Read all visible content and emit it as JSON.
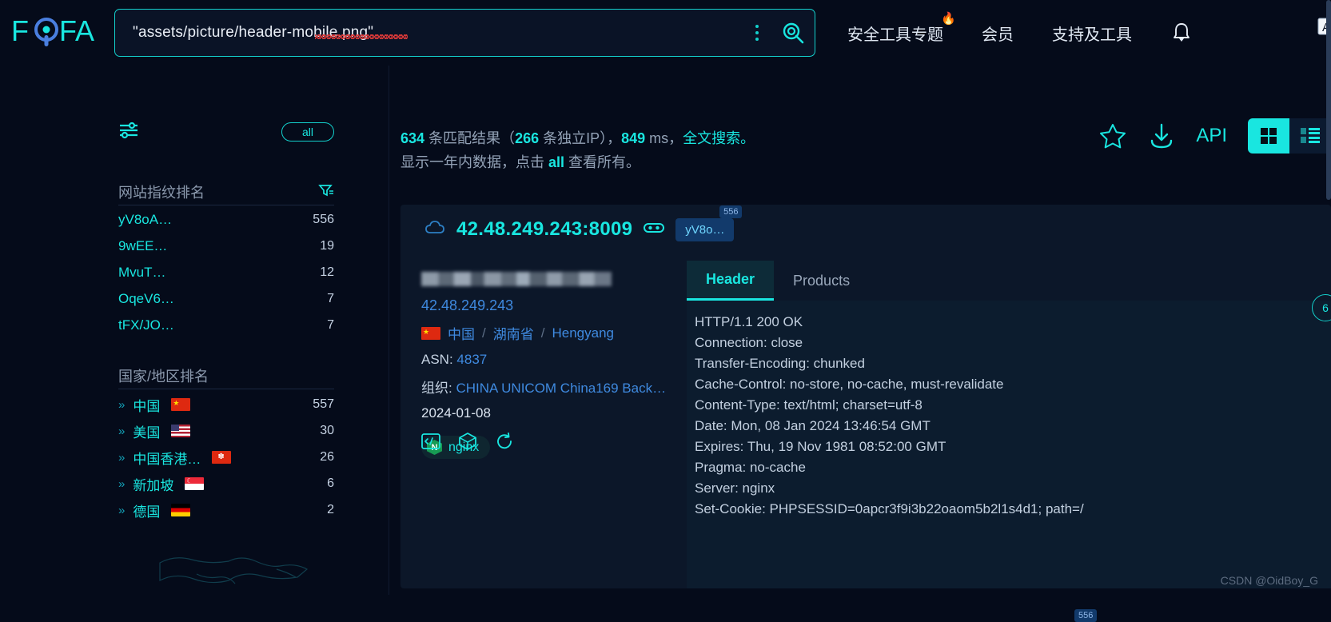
{
  "brand": {
    "name": "FOFA"
  },
  "search": {
    "query": "\"assets/picture/header-mobile.png\""
  },
  "nav": {
    "items": [
      {
        "label": "安全工具专题",
        "hot": true
      },
      {
        "label": "会员",
        "hot": false
      },
      {
        "label": "支持及工具",
        "hot": false
      }
    ]
  },
  "sidebar": {
    "all_label": "all",
    "sections": [
      {
        "title": "网站指纹排名",
        "items": [
          {
            "label": "yV8oA…",
            "count": "556"
          },
          {
            "label": "9wEE…",
            "count": "19"
          },
          {
            "label": "MvuT…",
            "count": "12"
          },
          {
            "label": "OqeV6…",
            "count": "7"
          },
          {
            "label": "tFX/JO…",
            "count": "7"
          }
        ]
      },
      {
        "title": "国家/地区排名",
        "items": [
          {
            "label": "中国",
            "count": "557",
            "flag": "f-cn"
          },
          {
            "label": "美国",
            "count": "30",
            "flag": "f-us"
          },
          {
            "label": "中国香港…",
            "count": "26",
            "flag": "f-hk"
          },
          {
            "label": "新加坡",
            "count": "6",
            "flag": "f-sg"
          },
          {
            "label": "德国",
            "count": "2",
            "flag": "f-de"
          }
        ]
      }
    ]
  },
  "results_meta": {
    "count": "634",
    "count_suffix": " 条匹配结果（",
    "unique_ip": "266",
    "unique_suffix": " 条独立IP），",
    "time": "849",
    "time_suffix": " ms，",
    "mode": "全文搜索。",
    "line2_prefix": "显示一年内数据，点击 ",
    "line2_link": "all",
    "line2_suffix": " 查看所有。"
  },
  "toolbar": {
    "api_label": "API"
  },
  "card": {
    "ip_port": "42.48.249.243:8009",
    "tag_label": "yV8o…",
    "tag_badge": "556",
    "ip": "42.48.249.243",
    "country": "中国",
    "province": "湖南省",
    "city": "Hengyang",
    "asn_label": "ASN:",
    "asn_value": "4837",
    "org_label": "组织:",
    "org_value": "CHINA UNICOM China169 Back…",
    "date": "2024-01-08",
    "service": "nginx",
    "service_badge": "N",
    "tabs": [
      {
        "label": "Header",
        "active": true
      },
      {
        "label": "Products",
        "active": false
      }
    ],
    "header_lines": [
      "HTTP/1.1 200 OK",
      "Connection: close",
      "Transfer-Encoding: chunked",
      "Cache-Control: no-store, no-cache, must-revalidate",
      "Content-Type: text/html; charset=utf-8",
      "Date: Mon, 08 Jan 2024 13:46:54 GMT",
      "Expires: Thu, 19 Nov 1981 08:52:00 GMT",
      "Pragma: no-cache",
      "Server: nginx",
      "Set-Cookie: PHPSESSID=0apcr3f9i3b22oaom5b2l1s4d1; path=/"
    ],
    "side_pill": "6"
  },
  "next_card_badge": "556",
  "watermark": "CSDN @OidBoy_G",
  "colors": {
    "accent": "#19e6e0",
    "link": "#3f8ae0",
    "bg": "#050b1a",
    "card": "#0c1729"
  }
}
